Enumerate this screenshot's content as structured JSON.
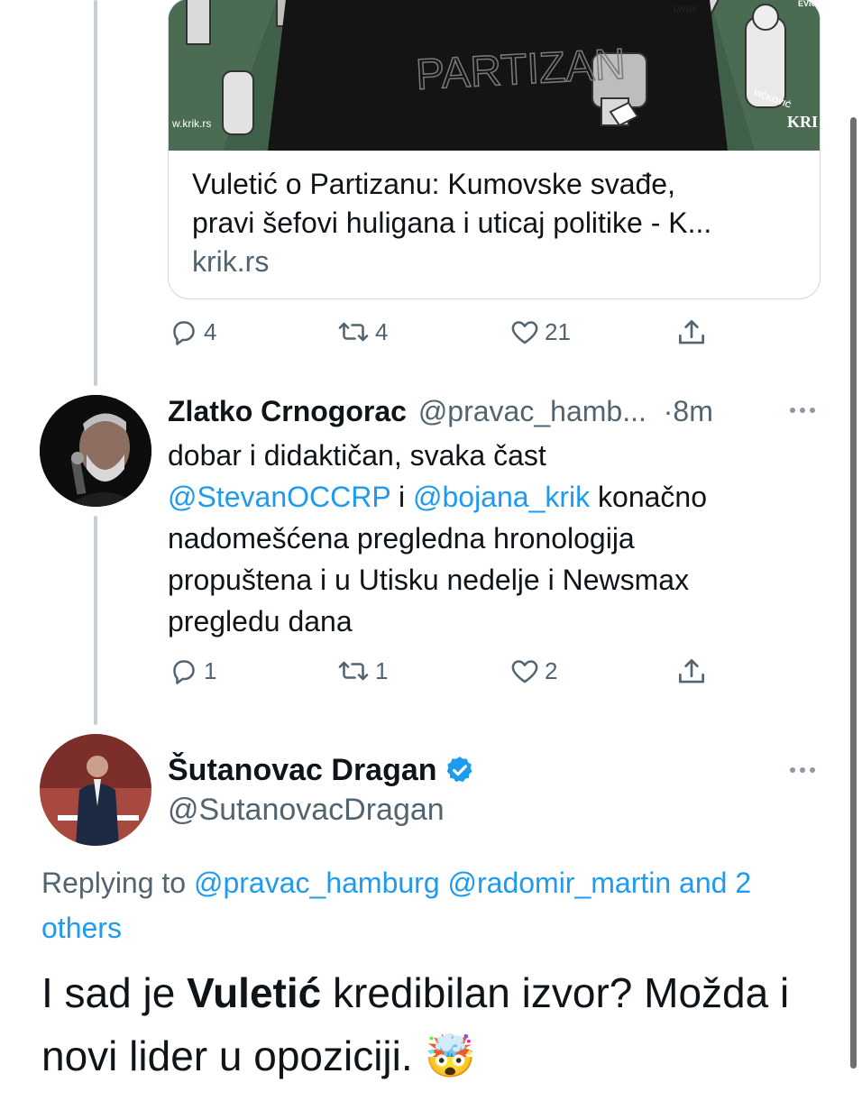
{
  "link_card": {
    "image_texts": {
      "jersey": "PARTIZAN",
      "watermark": "w.krik.rs",
      "corner_logo": "KRI",
      "sign_a": "LIVUK",
      "sign_b": "VIČKOVIĆ",
      "sign_c": "EVIĆ"
    },
    "title": "Vuletić o Partizanu: Kumovske svađe,\npravi šefovi huligana i uticaj politike - K...",
    "domain": "krik.rs"
  },
  "first_tweet_actions": {
    "replies": "4",
    "retweets": "4",
    "likes": "21"
  },
  "reply_tweet": {
    "author_name": "Zlatko Crnogorac",
    "handle": "@pravac_hamb...",
    "time": "·8m",
    "text_1": "dobar i didaktičan, svaka čast",
    "mention_1": "@StevanOCCRP",
    "conj": "i",
    "mention_2": "@bojana_krik",
    "text_2": "konačno",
    "text_3": "nadomešćena pregledna hronologija",
    "text_4": "propuštena i u Utisku nedelje i Newsmax",
    "text_5": "pregledu dana",
    "actions": {
      "replies": "1",
      "retweets": "1",
      "likes": "2"
    }
  },
  "main_tweet": {
    "author_name": "Šutanovac Dragan",
    "handle": "@SutanovacDragan",
    "replying_prefix": "Replying to",
    "replying_1": "@pravac_hamburg",
    "replying_2": "@radomir_martin",
    "replying_3": "and",
    "replying_4": "2 others",
    "body_1": "I sad je",
    "body_bold": "Vuletić",
    "body_2": "kredibilan izvor? Možda i",
    "body_3": "novi lider u opoziciji.",
    "emoji": "🤯"
  },
  "icons": [
    "reply-icon",
    "retweet-icon",
    "like-icon",
    "share-icon",
    "verified-badge-icon",
    "more-icon"
  ],
  "colors": {
    "link": "#1d9bf0",
    "muted": "#536471",
    "verified": "#1d9bf0"
  }
}
